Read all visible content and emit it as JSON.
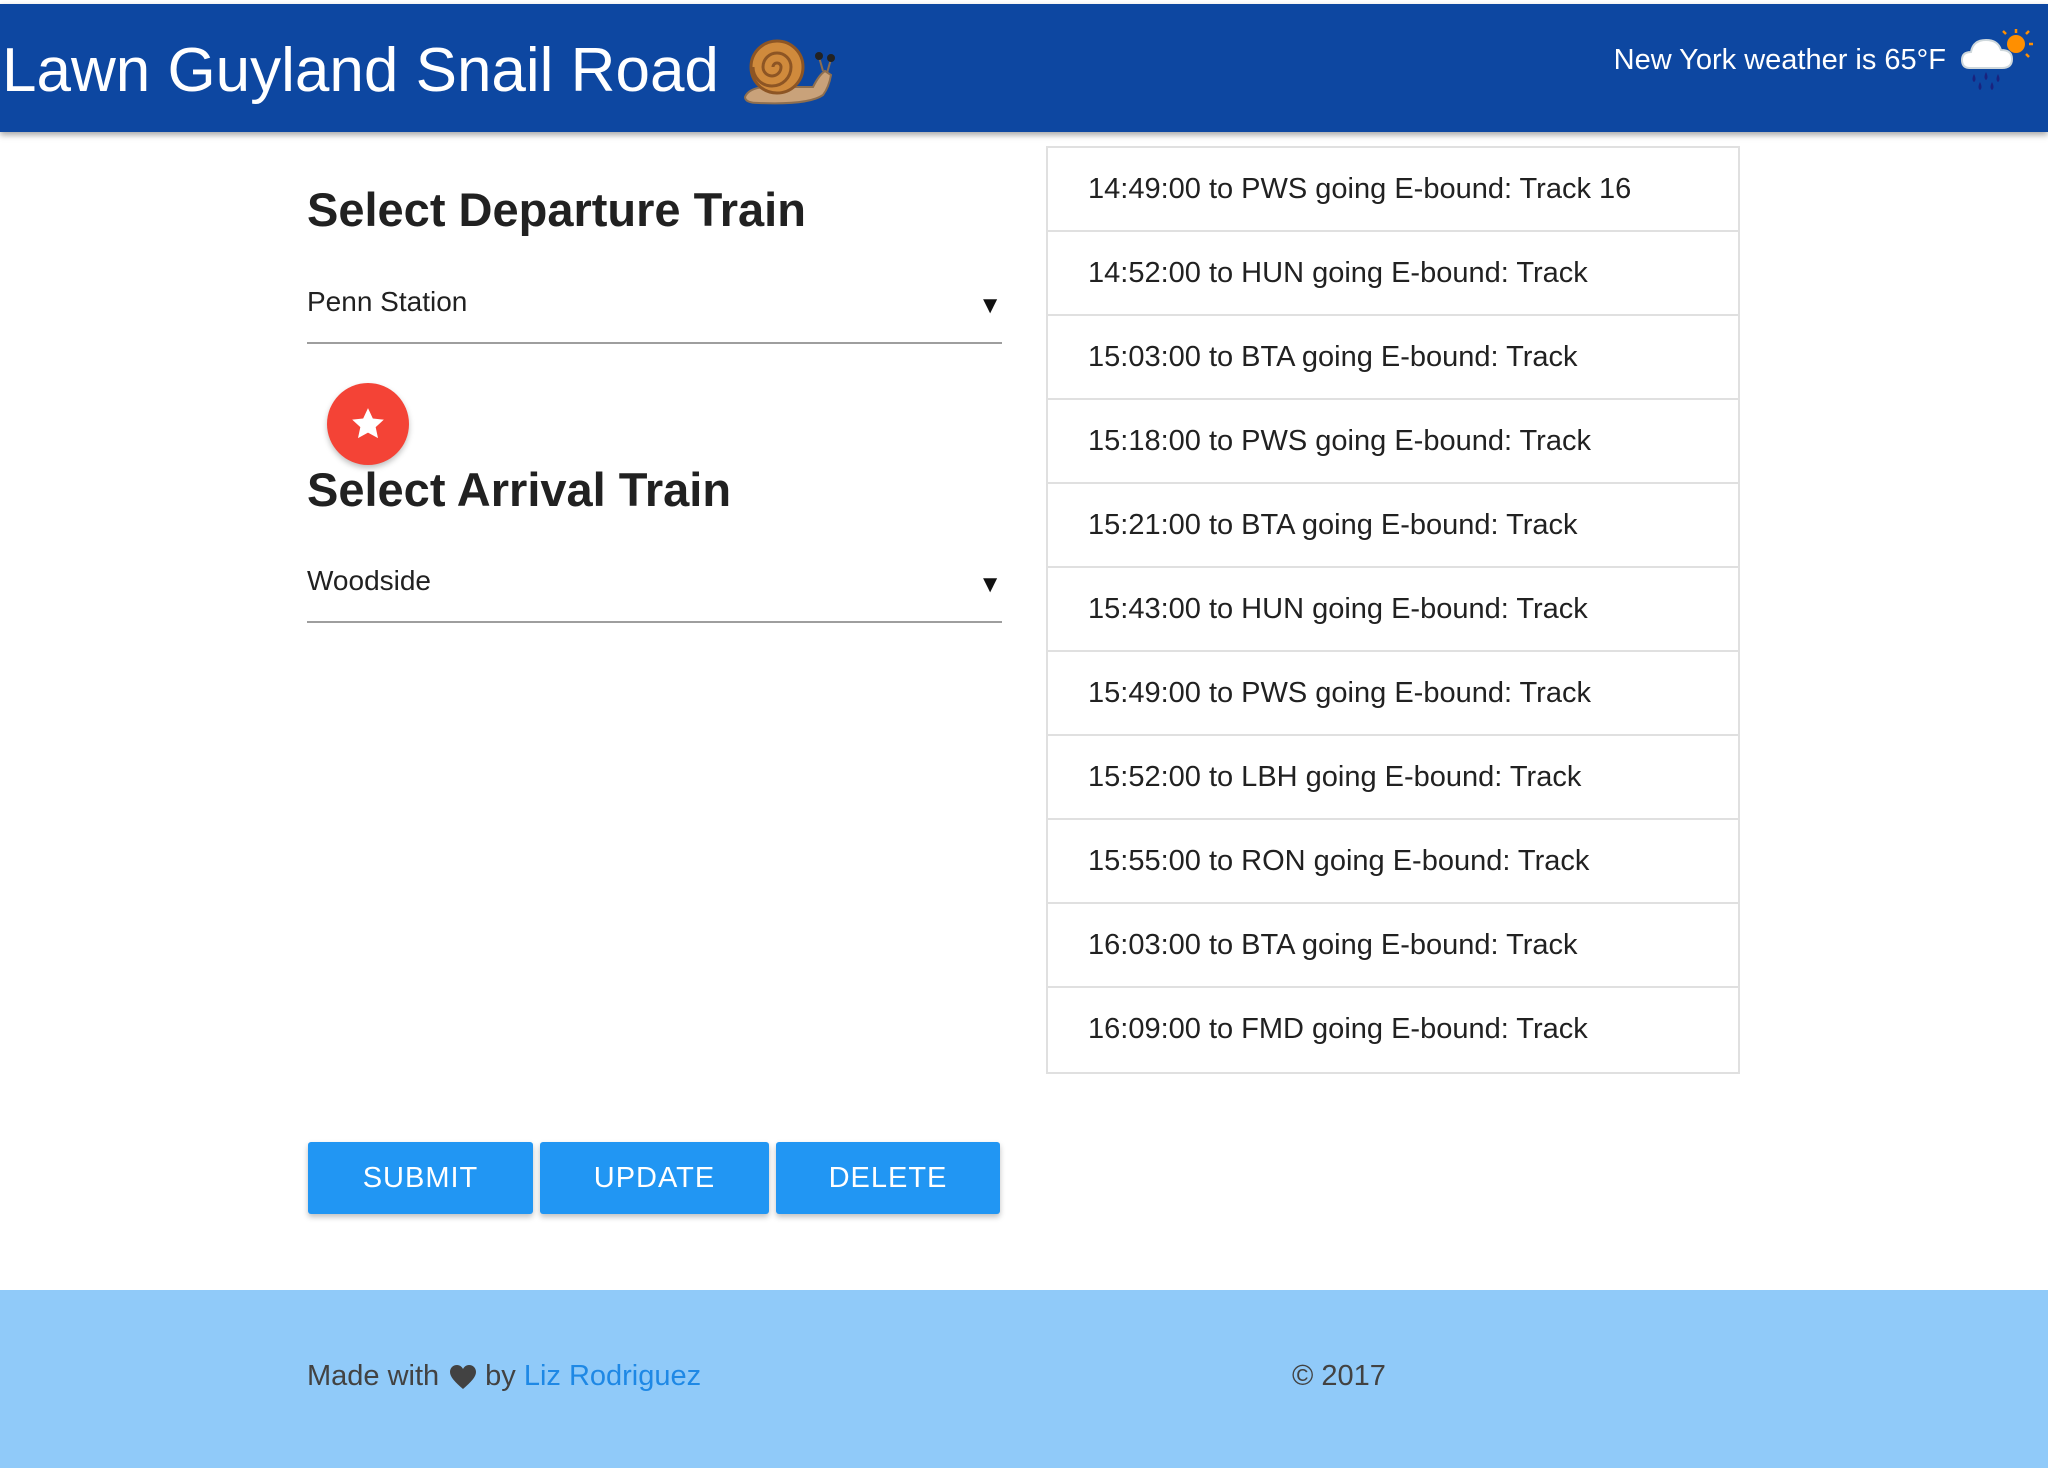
{
  "header": {
    "title": "Lawn Guyland Snail Road",
    "logo_icon": "snail-icon",
    "weather_text": "New York weather is 65°F",
    "weather_icon": "rain-cloud-sun-icon"
  },
  "departure": {
    "heading": "Select Departure Train",
    "selected": "Penn Station"
  },
  "favorite_icon": "star-icon",
  "arrival": {
    "heading": "Select Arrival Train",
    "selected": "Woodside"
  },
  "buttons": {
    "submit": "SUBMIT",
    "update": "UPDATE",
    "delete": "DELETE"
  },
  "trains": [
    "14:49:00 to PWS going E-bound: Track 16",
    "14:52:00 to HUN going E-bound: Track",
    "15:03:00 to BTA going E-bound: Track",
    "15:18:00 to PWS going E-bound: Track",
    "15:21:00 to BTA going E-bound: Track",
    "15:43:00 to HUN going E-bound: Track",
    "15:49:00 to PWS going E-bound: Track",
    "15:52:00 to LBH going E-bound: Track",
    "15:55:00 to RON going E-bound: Track",
    "16:03:00 to BTA going E-bound: Track",
    "16:09:00 to FMD going E-bound: Track"
  ],
  "footer": {
    "made_with": "Made with",
    "heart_icon": "heart-icon",
    "by": "by",
    "author": "Liz Rodriguez",
    "copyright": "© 2017"
  },
  "colors": {
    "header_bg": "#0d47a1",
    "button_bg": "#2196f3",
    "fab_bg": "#f44336",
    "footer_bg": "#90caf9",
    "link": "#1e88e5"
  }
}
